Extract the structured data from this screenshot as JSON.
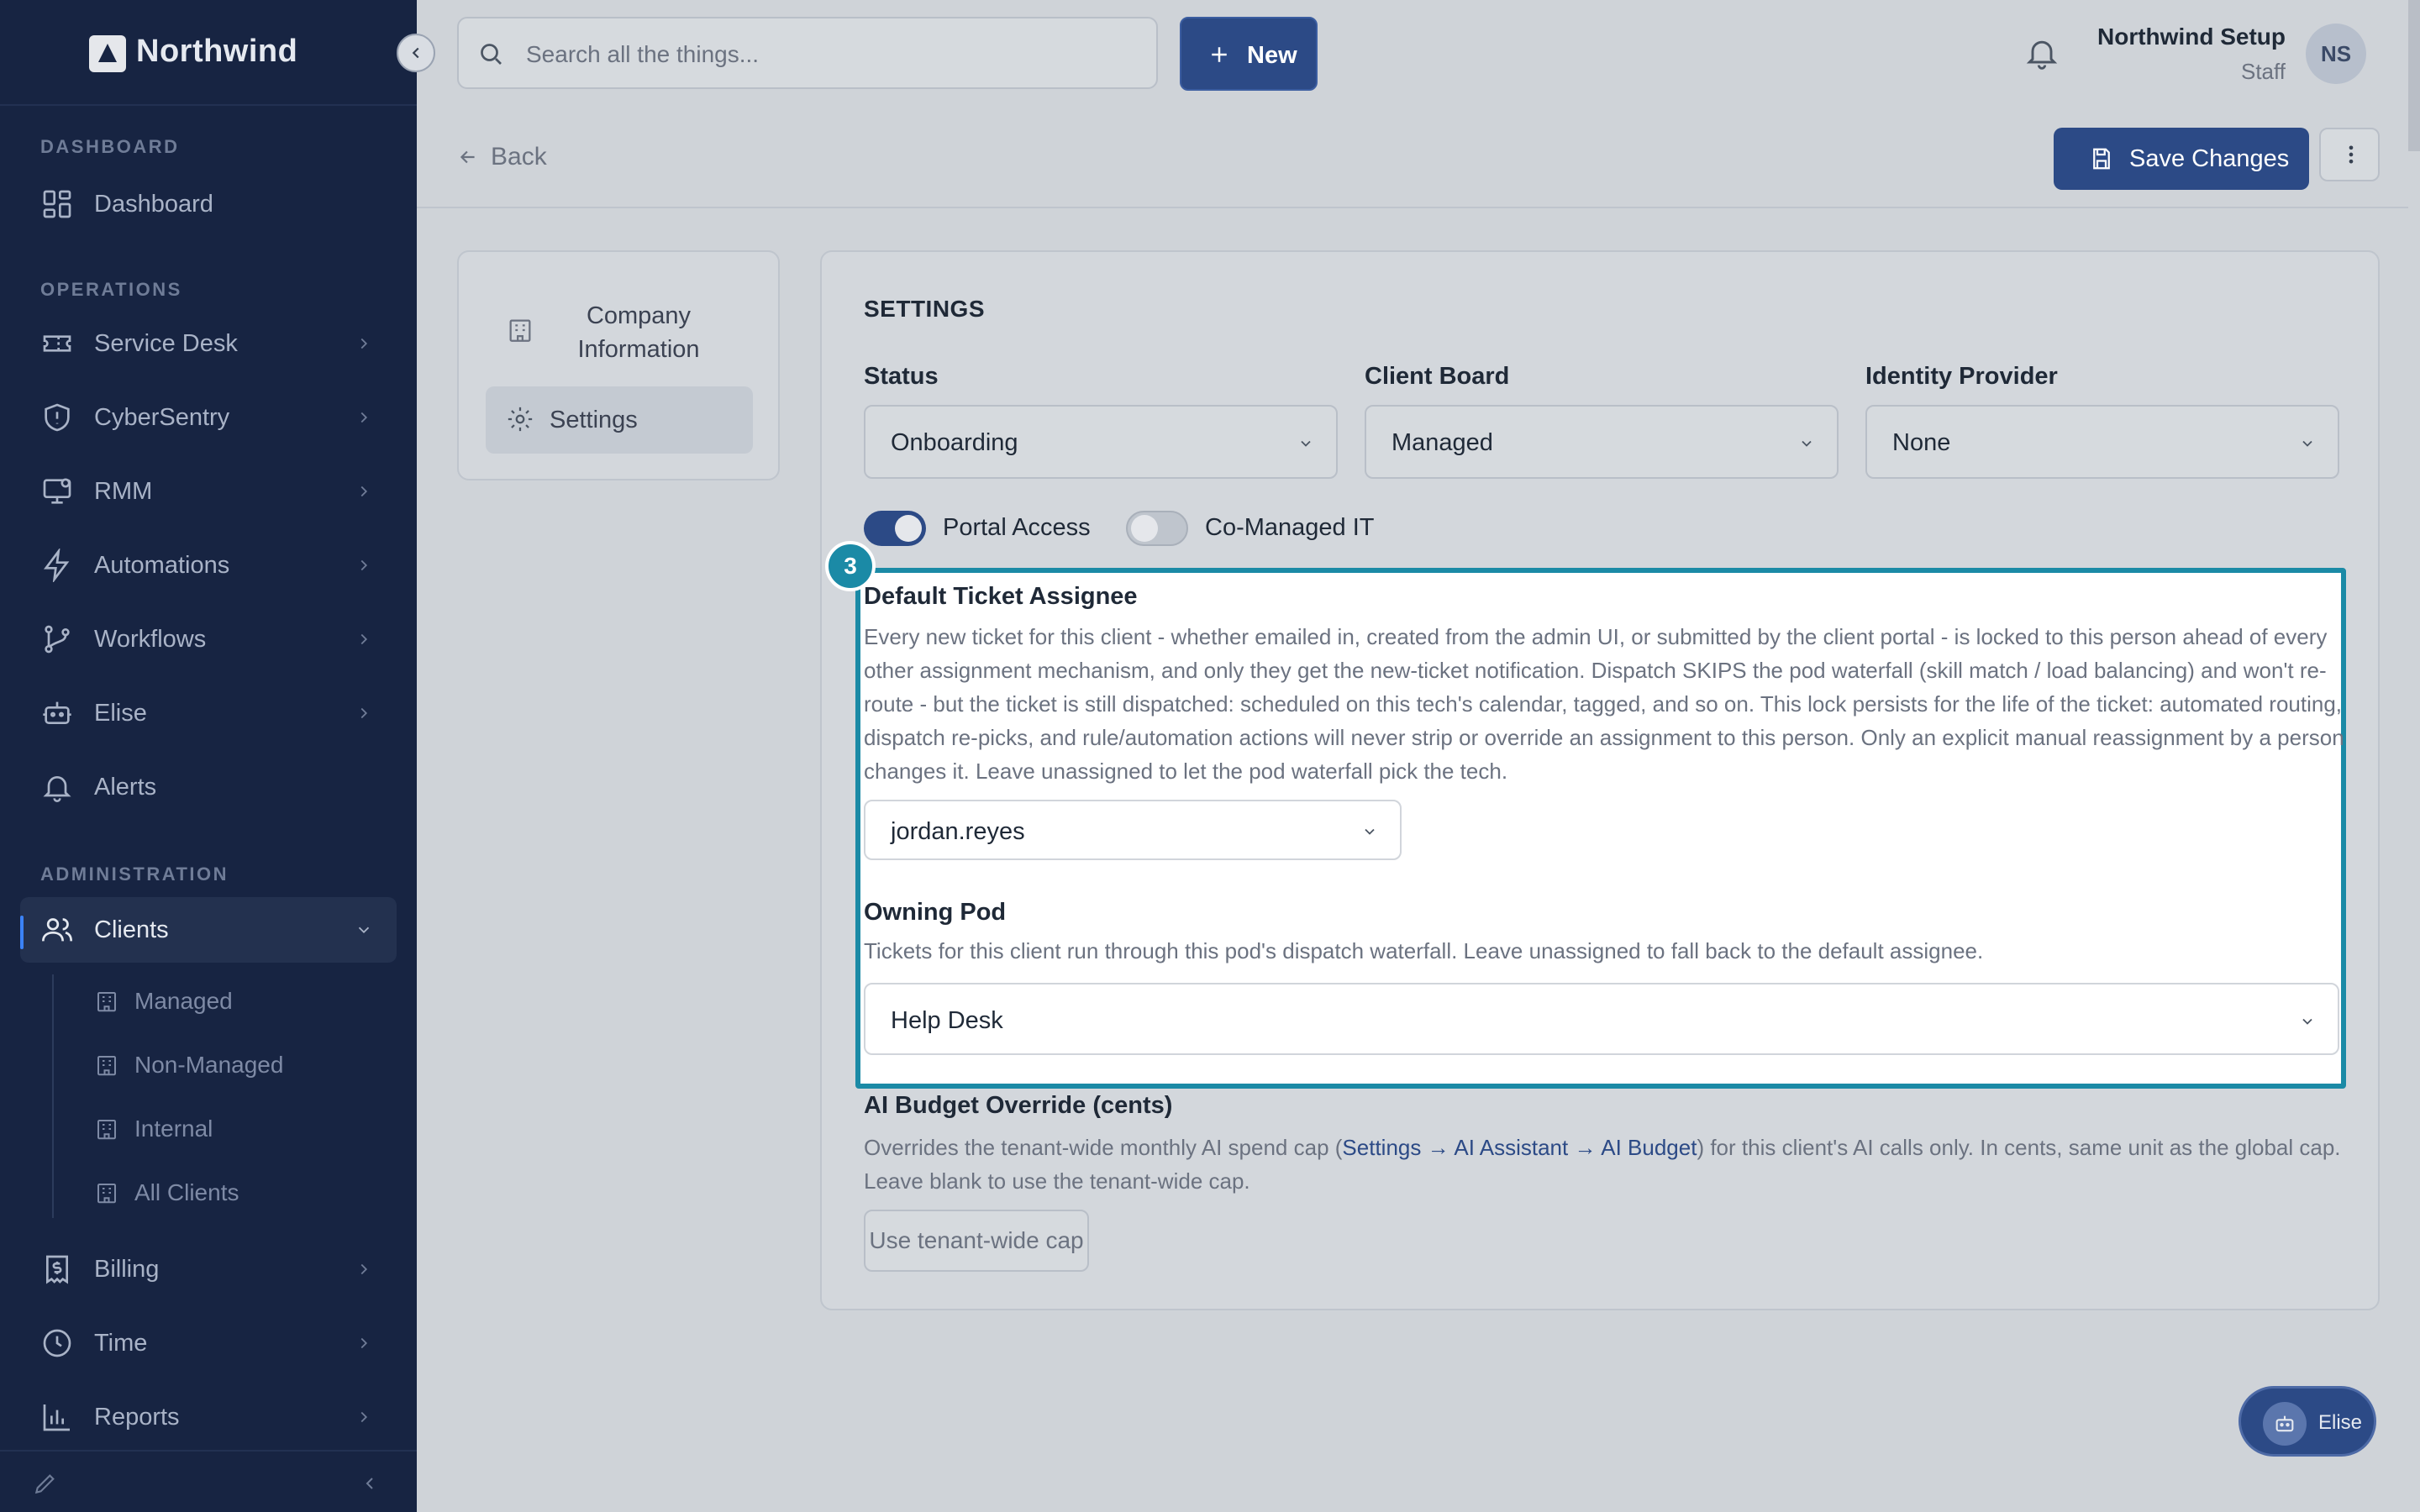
{
  "brand": {
    "name": "Northwind"
  },
  "sidebar": {
    "sections": {
      "dashboard": "DASHBOARD",
      "operations": "OPERATIONS",
      "administration": "ADMINISTRATION"
    },
    "items": {
      "dashboard": "Dashboard",
      "service_desk": "Service Desk",
      "cybersentry": "CyberSentry",
      "rmm": "RMM",
      "automations": "Automations",
      "workflows": "Workflows",
      "elise": "Elise",
      "alerts": "Alerts",
      "clients": "Clients",
      "billing": "Billing",
      "time": "Time",
      "reports": "Reports"
    },
    "client_subitems": {
      "managed": "Managed",
      "non_managed": "Non-Managed",
      "internal": "Internal",
      "all_clients": "All Clients"
    }
  },
  "topbar": {
    "search_placeholder": "Search all the things...",
    "new_label": "New",
    "user_name": "Northwind Setup",
    "user_role": "Staff",
    "avatar_initials": "NS"
  },
  "subheader": {
    "back_label": "Back",
    "save_label": "Save Changes"
  },
  "tabs": {
    "company": "Company Information",
    "settings": "Settings"
  },
  "settings": {
    "section_title": "SETTINGS",
    "status": {
      "label": "Status",
      "value": "Onboarding"
    },
    "client_board": {
      "label": "Client Board",
      "value": "Managed"
    },
    "identity_provider": {
      "label": "Identity Provider",
      "value": "None"
    },
    "portal_access": {
      "label": "Portal Access",
      "on": true
    },
    "co_managed": {
      "label": "Co-Managed IT",
      "on": false
    },
    "step_number": "3",
    "default_assignee": {
      "label": "Default Ticket Assignee",
      "description": "Every new ticket for this client - whether emailed in, created from the admin UI, or submitted by the client portal - is locked to this person ahead of every other assignment mechanism, and only they get the new-ticket notification. Dispatch SKIPS the pod waterfall (skill match / load balancing) and won't re-route - but the ticket is still dispatched: scheduled on this tech's calendar, tagged, and so on. This lock persists for the life of the ticket: automated routing, dispatch re-picks, and rule/automation actions will never strip or override an assignment to this person. Only an explicit manual reassignment by a person changes it. Leave unassigned to let the pod waterfall pick the tech.",
      "value": "jordan.reyes"
    },
    "owning_pod": {
      "label": "Owning Pod",
      "description": "Tickets for this client run through this pod's dispatch waterfall. Leave unassigned to fall back to the default assignee.",
      "value": "Help Desk"
    },
    "ai_budget": {
      "label": "AI Budget Override (cents)",
      "desc_prefix": "Overrides the tenant-wide monthly AI spend cap (",
      "desc_link": "Settings → AI Assistant → AI Budget",
      "desc_suffix": ") for this client's AI calls only. In cents, same unit as the global cap. Leave blank to use the tenant-wide cap.",
      "button_label": "Use tenant-wide cap"
    }
  },
  "fab": {
    "label": "Elise"
  },
  "colors": {
    "sidebar": "#172442",
    "accent": "#2c4a86",
    "highlight": "#1b8aa6"
  }
}
